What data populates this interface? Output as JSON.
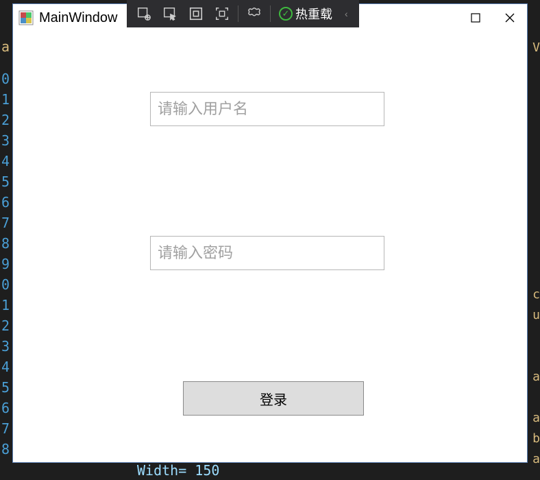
{
  "ide": {
    "line_numbers": [
      "0",
      "1",
      "2",
      "3",
      "4",
      "5",
      "6",
      "7",
      "8",
      "9",
      "0",
      "1",
      "2",
      "3",
      "4",
      "5",
      "6",
      "7",
      "8"
    ],
    "right_chars": [
      "V",
      "",
      "",
      "",
      "",
      "",
      "",
      "",
      "",
      "",
      "",
      "",
      "c",
      "u",
      "",
      "",
      "a",
      "",
      "a",
      "b",
      "a"
    ],
    "top_a": "a",
    "bottom_text": "Width= 150"
  },
  "debug_toolbar": {
    "hot_reload_label": "热重载"
  },
  "window": {
    "title": "MainWindow"
  },
  "form": {
    "username_placeholder": "请输入用户名",
    "password_placeholder": "请输入密码",
    "login_label": "登录"
  }
}
